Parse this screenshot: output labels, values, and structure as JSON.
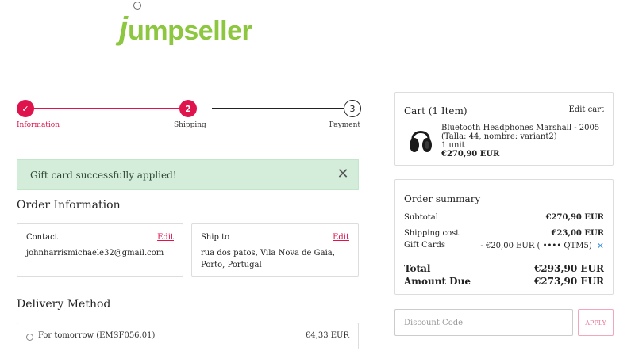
{
  "brand": {
    "logo_first": "j",
    "logo_rest": "umpseller",
    "color": "#8dc63f"
  },
  "stepper": {
    "steps": [
      {
        "label": "Information",
        "marker": "✓"
      },
      {
        "label": "Shipping",
        "marker": "2"
      },
      {
        "label": "Payment",
        "marker": "3"
      }
    ],
    "accent": "#e0144c"
  },
  "alert": {
    "message": "Gift card successfully applied!"
  },
  "order_info": {
    "title": "Order Information",
    "contact": {
      "heading": "Contact",
      "edit": "Edit",
      "value": "johnharrismichaele32@gmail.com"
    },
    "ship_to": {
      "heading": "Ship to",
      "edit": "Edit",
      "value": "rua dos patos, Vila Nova de Gaia, Porto, Portugal"
    }
  },
  "delivery": {
    "title": "Delivery Method",
    "options": [
      {
        "label": "For tomorrow (EMSF056.01)",
        "price": "€4,33 EUR"
      }
    ]
  },
  "cart": {
    "title": "Cart (1 Item)",
    "edit": "Edit cart",
    "item": {
      "name": "Bluetooth Headphones Marshall - 2005 (Talla: 44, nombre: variant2)",
      "qty": "1 unit",
      "price": "€270,90 EUR",
      "icon": "headphones-image"
    }
  },
  "summary": {
    "title": "Order summary",
    "subtotal_label": "Subtotal",
    "subtotal": "€270,90 EUR",
    "shipping_label": "Shipping cost",
    "shipping": "€23,00 EUR",
    "gift_label": "Gift Cards",
    "gift": "- €20,00 EUR ( •••• QTM5)",
    "total_label": "Total",
    "total": "€293,90 EUR",
    "due_label": "Amount Due",
    "due": "€273,90 EUR"
  },
  "discount": {
    "placeholder": "Discount Code",
    "apply": "APPLY"
  }
}
